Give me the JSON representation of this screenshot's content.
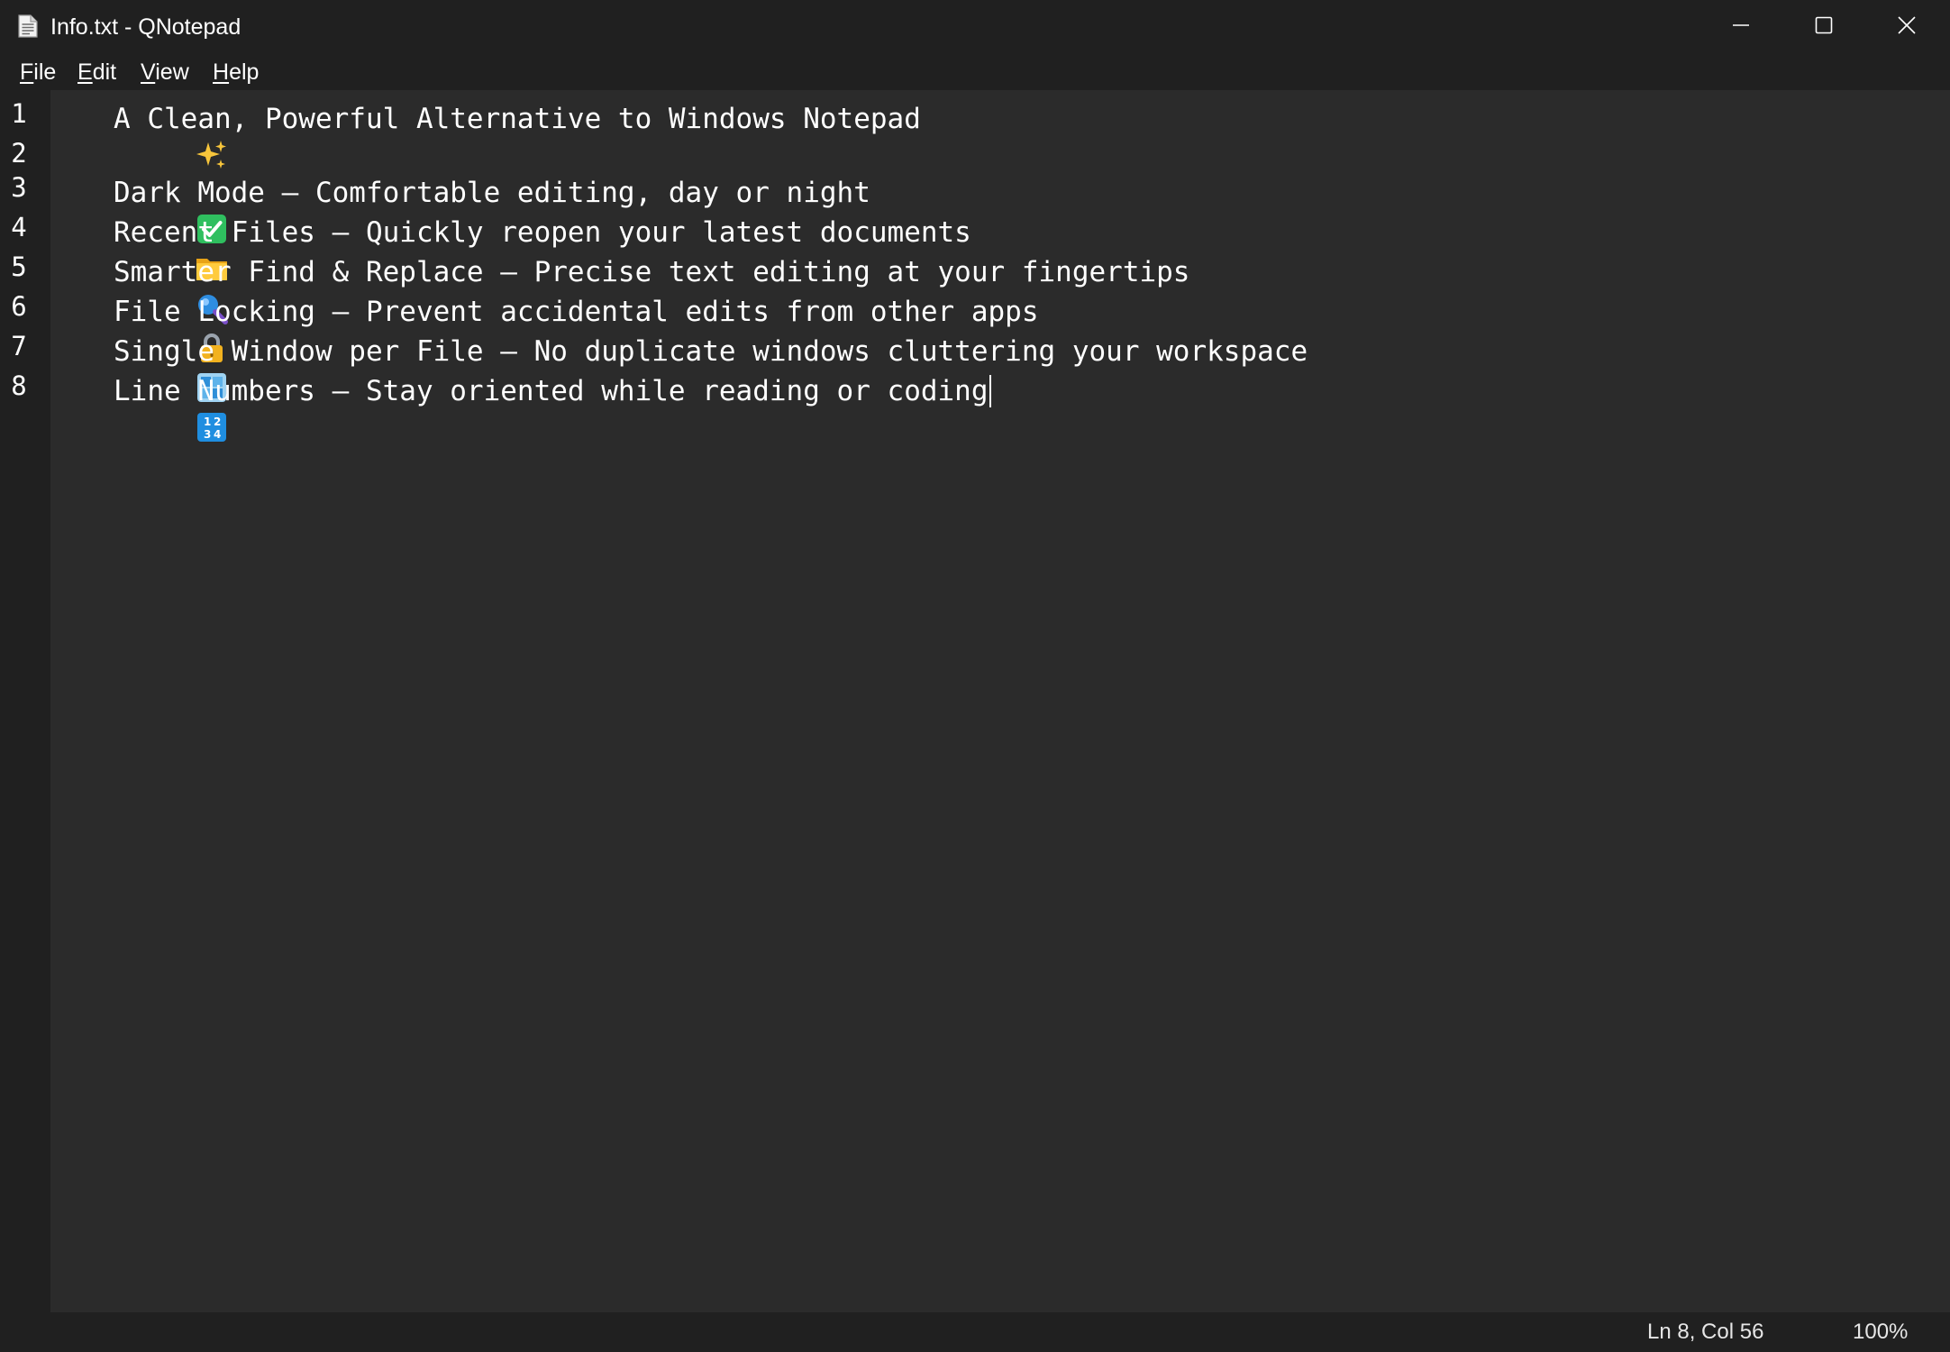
{
  "window": {
    "title": "Info.txt - QNotepad",
    "app_icon": "document-icon",
    "controls": [
      "minimize-icon",
      "maximize-icon",
      "close-icon"
    ]
  },
  "menu": {
    "file": {
      "label": "File",
      "mnemonic": "F",
      "rest": "ile"
    },
    "edit": {
      "label": "Edit",
      "mnemonic": "E",
      "rest": "dit"
    },
    "view": {
      "label": "View",
      "mnemonic": "V",
      "rest": "iew"
    },
    "help": {
      "label": "Help",
      "mnemonic": "H",
      "rest": "elp"
    }
  },
  "editor": {
    "line_numbers": [
      "1",
      "2",
      "3",
      "4",
      "5",
      "6",
      "7",
      "8"
    ],
    "lines": [
      {
        "icon": "sparkles-icon",
        "text": "A Clean, Powerful Alternative to Windows Notepad"
      },
      {
        "icon": "",
        "text": ""
      },
      {
        "icon": "check-mark-icon",
        "text": "Dark Mode – Comfortable editing, day or night"
      },
      {
        "icon": "folder-icon",
        "text": "Recent Files – Quickly reopen your latest documents"
      },
      {
        "icon": "magnifier-icon",
        "text": "Smarter Find & Replace – Precise text editing at your fingertips"
      },
      {
        "icon": "lock-icon",
        "text": "File Locking – Prevent accidental edits from other apps"
      },
      {
        "icon": "window-icon",
        "text": "Single Window per File – No duplicate windows cluttering your workspace"
      },
      {
        "icon": "numbers-icon",
        "text": "Line Numbers – Stay oriented while reading or coding"
      }
    ]
  },
  "status": {
    "position": "Ln 8, Col 56",
    "zoom": "100%"
  },
  "colors": {
    "chrome_bg": "#202020",
    "editor_bg": "#2b2b2b",
    "text": "#ffffff"
  }
}
